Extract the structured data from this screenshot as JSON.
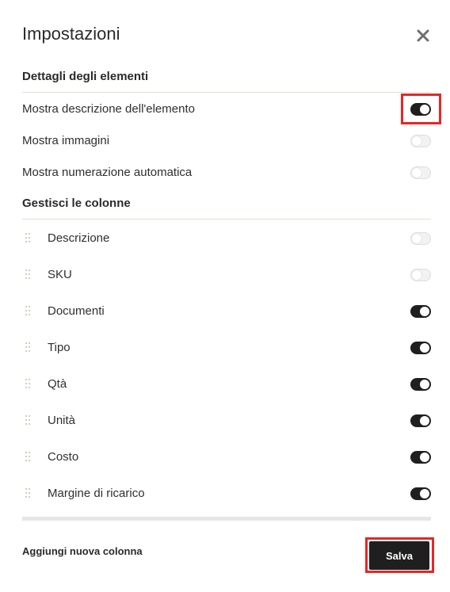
{
  "dialog": {
    "title": "Impostazioni",
    "close_icon": "close-icon"
  },
  "item_details": {
    "heading": "Dettagli degli elementi",
    "options": [
      {
        "label": "Mostra descrizione dell'elemento",
        "enabled": true
      },
      {
        "label": "Mostra immagini",
        "enabled": false
      },
      {
        "label": "Mostra numerazione automatica",
        "enabled": false
      }
    ]
  },
  "columns": {
    "heading": "Gestisci le colonne",
    "handle_icon": "drag-handle-icon",
    "items": [
      {
        "label": "Descrizione",
        "enabled": false
      },
      {
        "label": "SKU",
        "enabled": false
      },
      {
        "label": "Documenti",
        "enabled": true
      },
      {
        "label": "Tipo",
        "enabled": true
      },
      {
        "label": "Qtà",
        "enabled": true
      },
      {
        "label": "Unità",
        "enabled": true
      },
      {
        "label": "Costo",
        "enabled": true
      },
      {
        "label": "Margine di ricarico",
        "enabled": true
      }
    ]
  },
  "footer": {
    "add_column_label": "Aggiungi nuova colonna",
    "save_label": "Salva"
  },
  "colors": {
    "toggle_on": "#1f1f1f",
    "toggle_off": "#f2f2f2",
    "divider": "#e3ddd2",
    "highlight": "#e82525"
  }
}
